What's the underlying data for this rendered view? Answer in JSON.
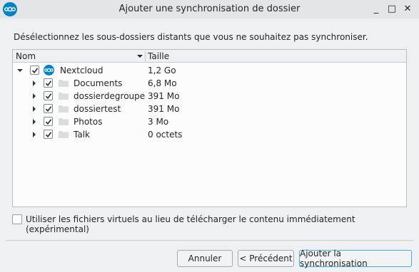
{
  "window": {
    "title": "Ajouter une synchronisation de dossier",
    "minimize_label": "_",
    "maximize_label": "□",
    "close_label": "✕"
  },
  "instruction": "Désélectionnez les sous-dossiers distants que vous ne souhaitez pas synchroniser.",
  "tree": {
    "columns": {
      "name": "Nom",
      "size": "Taille"
    },
    "root": {
      "name": "Nextcloud",
      "size": "1,2 Go",
      "checked": true,
      "expanded": true
    },
    "items": [
      {
        "name": "Documents",
        "size": "6,8 Mo",
        "checked": true
      },
      {
        "name": "dossierdegroupe",
        "size": "391 Mo",
        "checked": true
      },
      {
        "name": "dossiertest",
        "size": "391 Mo",
        "checked": true
      },
      {
        "name": "Photos",
        "size": "3 Mo",
        "checked": true
      },
      {
        "name": "Talk",
        "size": "0 octets",
        "checked": true
      }
    ]
  },
  "virtual_files": {
    "label": "Utiliser les fichiers virtuels au lieu de télécharger le contenu immédiatement  (expérimental)",
    "checked": false
  },
  "buttons": {
    "cancel": "Annuler",
    "previous": "< Précédent",
    "add_sync": "Ajouter la synchronisation"
  },
  "colors": {
    "accent": "#0082c9",
    "focus": "#3daee9"
  }
}
